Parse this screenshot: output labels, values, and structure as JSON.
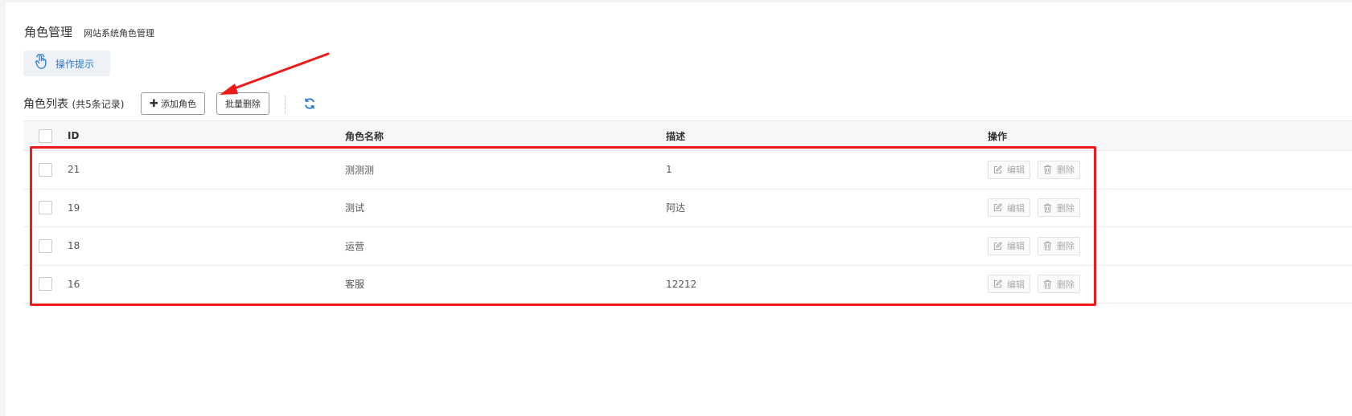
{
  "header": {
    "title": "角色管理",
    "subtitle": "网站系统角色管理"
  },
  "tip_button": {
    "label": "操作提示",
    "icon": "hand-pointer-icon"
  },
  "toolbar": {
    "list_title": "角色列表",
    "record_count": "(共5条记录)",
    "add_label": "添加角色",
    "batch_delete_label": "批量删除",
    "refresh_icon": "refresh-icon"
  },
  "table": {
    "columns": [
      "ID",
      "角色名称",
      "描述",
      "操作"
    ],
    "rows": [
      {
        "id": "21",
        "name": "测测测",
        "desc": "1"
      },
      {
        "id": "19",
        "name": "测试",
        "desc": "阿达"
      },
      {
        "id": "18",
        "name": "运营",
        "desc": ""
      },
      {
        "id": "16",
        "name": "客服",
        "desc": "12212"
      }
    ],
    "edit_label": "编辑",
    "delete_label": "删除"
  },
  "colors": {
    "accent": "#2b7ad6",
    "annotation": "#ee1b1b"
  }
}
